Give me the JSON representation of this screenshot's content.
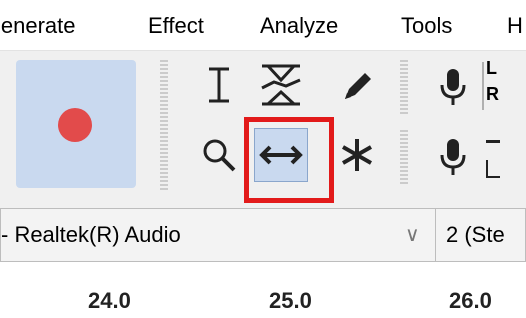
{
  "menu": {
    "items": [
      {
        "label": "ienerate"
      },
      {
        "label": "Effect"
      },
      {
        "label": "Analyze"
      },
      {
        "label": "Tools"
      },
      {
        "label": "H"
      }
    ]
  },
  "toolbar": {
    "record_button": {
      "icon": "record-icon",
      "color": "#e24b4b"
    },
    "tools": [
      {
        "name": "selection-tool",
        "icon": "i-beam-icon"
      },
      {
        "name": "envelope-tool",
        "icon": "envelope-icon"
      },
      {
        "name": "draw-tool",
        "icon": "pencil-icon"
      },
      {
        "name": "zoom-tool",
        "icon": "magnifier-icon"
      },
      {
        "name": "time-shift-tool",
        "icon": "left-right-arrow-icon",
        "selected": true
      },
      {
        "name": "multi-tool",
        "icon": "asterisk-icon"
      }
    ],
    "meter_labels": {
      "l": "L",
      "r": "R"
    }
  },
  "device": {
    "recording_device": "- Realtek(R) Audio",
    "channels": "2 (Ste"
  },
  "ruler": {
    "ticks": [
      "24.0",
      "25.0",
      "26.0"
    ]
  },
  "colors": {
    "highlight": "#e21a1a",
    "selected_bg": "#c9d9ef"
  }
}
